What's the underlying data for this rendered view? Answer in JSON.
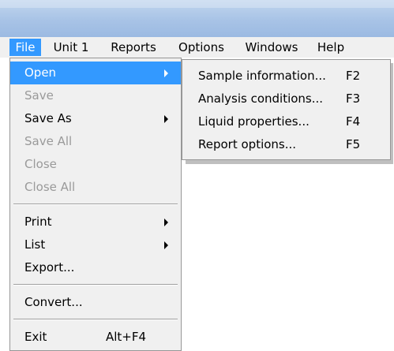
{
  "menubar": {
    "items": [
      {
        "label": "File"
      },
      {
        "label": "Unit 1"
      },
      {
        "label": "Reports"
      },
      {
        "label": "Options"
      },
      {
        "label": "Windows"
      },
      {
        "label": "Help"
      }
    ]
  },
  "file_menu": {
    "items": [
      {
        "label": "Open"
      },
      {
        "label": "Save"
      },
      {
        "label": "Save As"
      },
      {
        "label": "Save All"
      },
      {
        "label": "Close"
      },
      {
        "label": "Close All"
      },
      {
        "label": "Print"
      },
      {
        "label": "List"
      },
      {
        "label": "Export..."
      },
      {
        "label": "Convert..."
      },
      {
        "label": "Exit",
        "shortcut": "Alt+F4"
      }
    ]
  },
  "open_submenu": {
    "items": [
      {
        "label": "Sample information...",
        "shortcut": "F2"
      },
      {
        "label": "Analysis conditions...",
        "shortcut": "F3"
      },
      {
        "label": "Liquid properties...",
        "shortcut": "F4"
      },
      {
        "label": "Report options...",
        "shortcut": "F5"
      }
    ]
  },
  "colors": {
    "highlight": "#3399ff",
    "menu_background": "#f0f0f0",
    "disabled_text": "#9a9a9a",
    "titlebar": "#a8c3e6"
  }
}
